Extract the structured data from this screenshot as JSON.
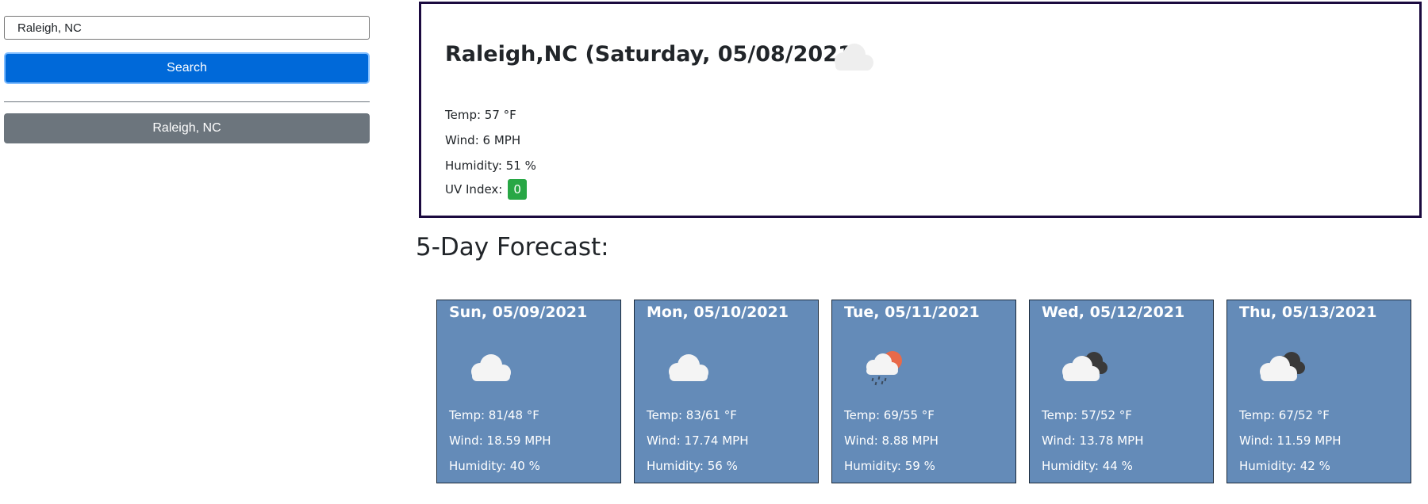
{
  "search": {
    "value": "Raleigh, NC",
    "button_label": "Search"
  },
  "history": [
    {
      "label": "Raleigh, NC"
    }
  ],
  "current": {
    "title": "Raleigh,NC (Saturday, 05/08/2021)",
    "icon": "cloud-icon",
    "temp": "Temp: 57 °F",
    "wind": "Wind: 6 MPH",
    "humidity": "Humidity: 51 %",
    "uv_label": "UV Index:",
    "uv_value": "0",
    "uv_color": "#28a745"
  },
  "forecast": {
    "heading": "5-Day Forecast:",
    "days": [
      {
        "date": "Sun, 05/09/2021",
        "icon": "cloud-icon",
        "temp": "Temp: 81/48 °F",
        "wind": "Wind: 18.59 MPH",
        "humidity": "Humidity: 40 %"
      },
      {
        "date": "Mon, 05/10/2021",
        "icon": "cloud-icon",
        "temp": "Temp: 83/61 °F",
        "wind": "Wind: 17.74 MPH",
        "humidity": "Humidity: 56 %"
      },
      {
        "date": "Tue, 05/11/2021",
        "icon": "rain-sun-icon",
        "temp": "Temp: 69/55 °F",
        "wind": "Wind: 8.88 MPH",
        "humidity": "Humidity: 59 %"
      },
      {
        "date": "Wed, 05/12/2021",
        "icon": "broken-clouds-icon",
        "temp": "Temp: 57/52 °F",
        "wind": "Wind: 13.78 MPH",
        "humidity": "Humidity: 44 %"
      },
      {
        "date": "Thu, 05/13/2021",
        "icon": "broken-clouds-icon",
        "temp": "Temp: 67/52 °F",
        "wind": "Wind: 11.59 MPH",
        "humidity": "Humidity: 42 %"
      }
    ]
  },
  "colors": {
    "search_button": "#0069d9",
    "history_button": "#6c757d",
    "card_background": "#648bb8",
    "current_border": "#1b0a3f"
  }
}
